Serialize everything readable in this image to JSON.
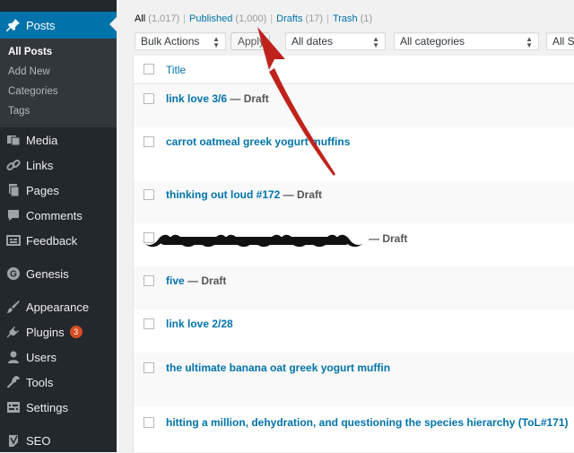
{
  "sidebar": {
    "posts": {
      "label": "Posts",
      "icon": "pin-icon"
    },
    "submenu": [
      {
        "label": "All Posts",
        "current": true
      },
      {
        "label": "Add New"
      },
      {
        "label": "Categories"
      },
      {
        "label": "Tags"
      }
    ],
    "items": [
      {
        "label": "Media",
        "icon": "media-icon"
      },
      {
        "label": "Links",
        "icon": "links-icon"
      },
      {
        "label": "Pages",
        "icon": "pages-icon"
      },
      {
        "label": "Comments",
        "icon": "comments-icon"
      },
      {
        "label": "Feedback",
        "icon": "feedback-icon"
      },
      {
        "label": "Genesis",
        "icon": "genesis-icon"
      },
      {
        "label": "Appearance",
        "icon": "appearance-icon"
      },
      {
        "label": "Plugins",
        "icon": "plugins-icon",
        "badge": "3"
      },
      {
        "label": "Users",
        "icon": "users-icon"
      },
      {
        "label": "Tools",
        "icon": "tools-icon"
      },
      {
        "label": "Settings",
        "icon": "settings-icon"
      },
      {
        "label": "SEO",
        "icon": "seo-icon"
      }
    ]
  },
  "filters": {
    "all": {
      "label": "All",
      "count": "(1,017)"
    },
    "published": {
      "label": "Published",
      "count": "(1,000)"
    },
    "drafts": {
      "label": "Drafts",
      "count": "(17)"
    },
    "trash": {
      "label": "Trash",
      "count": "(1)"
    },
    "separator": "|"
  },
  "toolbar": {
    "bulk_actions": "Bulk Actions",
    "apply": "Apply",
    "dates": "All dates",
    "categories": "All categories",
    "seo": "All SE"
  },
  "table": {
    "title_header": "Title",
    "rows": [
      {
        "title": "link love 3/6",
        "state": " — Draft"
      },
      {
        "title": "carrot oatmeal greek yogurt muffins",
        "state": ""
      },
      {
        "title": "thinking out loud #172",
        "state": " — Draft"
      },
      {
        "title": "",
        "state": "— Draft",
        "redacted": true
      },
      {
        "title": "five",
        "state": " — Draft"
      },
      {
        "title": "link love 2/28",
        "state": ""
      },
      {
        "title": "the ultimate banana oat greek yogurt muffin",
        "state": ""
      },
      {
        "title": "hitting a million, dehydration, and questioning the species hierarchy (ToL#171)",
        "state": ""
      }
    ]
  },
  "colors": {
    "sidebar_bg": "#23282d",
    "submenu_bg": "#32373c",
    "accent": "#0073aa",
    "badge": "#d54e21",
    "annotation_arrow": "#c0221c"
  }
}
